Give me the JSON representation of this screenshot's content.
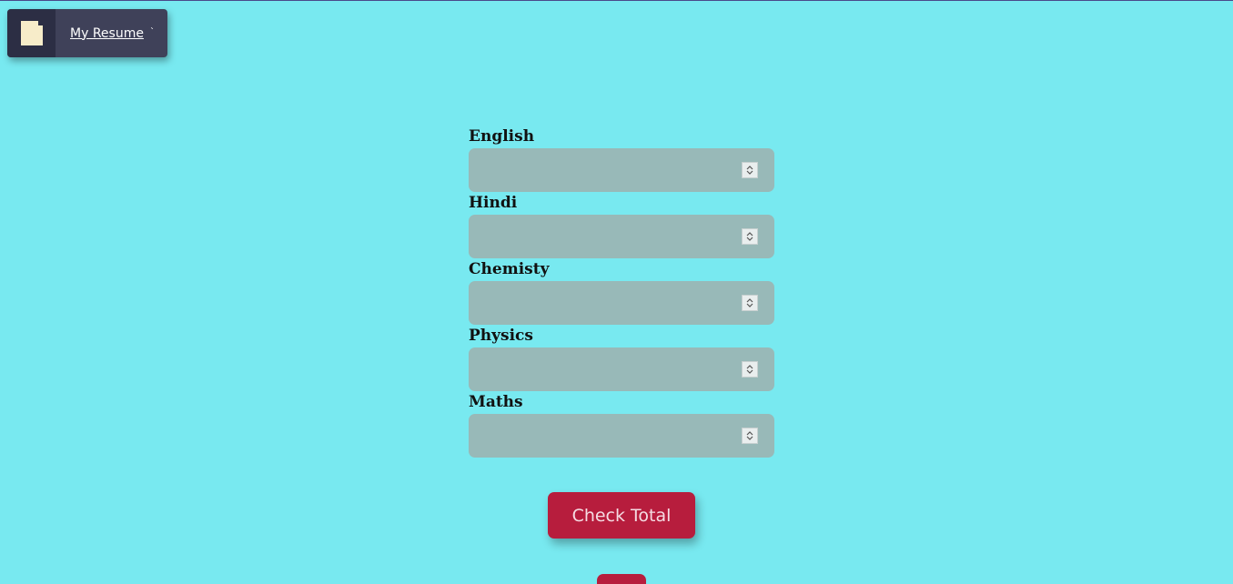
{
  "nav": {
    "resume_label": "My Resume",
    "resume_tick": "`"
  },
  "form": {
    "fields": [
      {
        "label": "English",
        "value": ""
      },
      {
        "label": "Hindi",
        "value": ""
      },
      {
        "label": "Chemisty",
        "value": ""
      },
      {
        "label": "Physics",
        "value": ""
      },
      {
        "label": "Maths",
        "value": ""
      }
    ],
    "submit_label": "Check Total"
  },
  "colors": {
    "background": "#78e9f0",
    "field_bg": "#98b9b8",
    "button": "#b71d3d",
    "tab": "#3f4159"
  },
  "icons": {
    "resume": "document-icon",
    "spinner": "spinner-updown-icon"
  }
}
